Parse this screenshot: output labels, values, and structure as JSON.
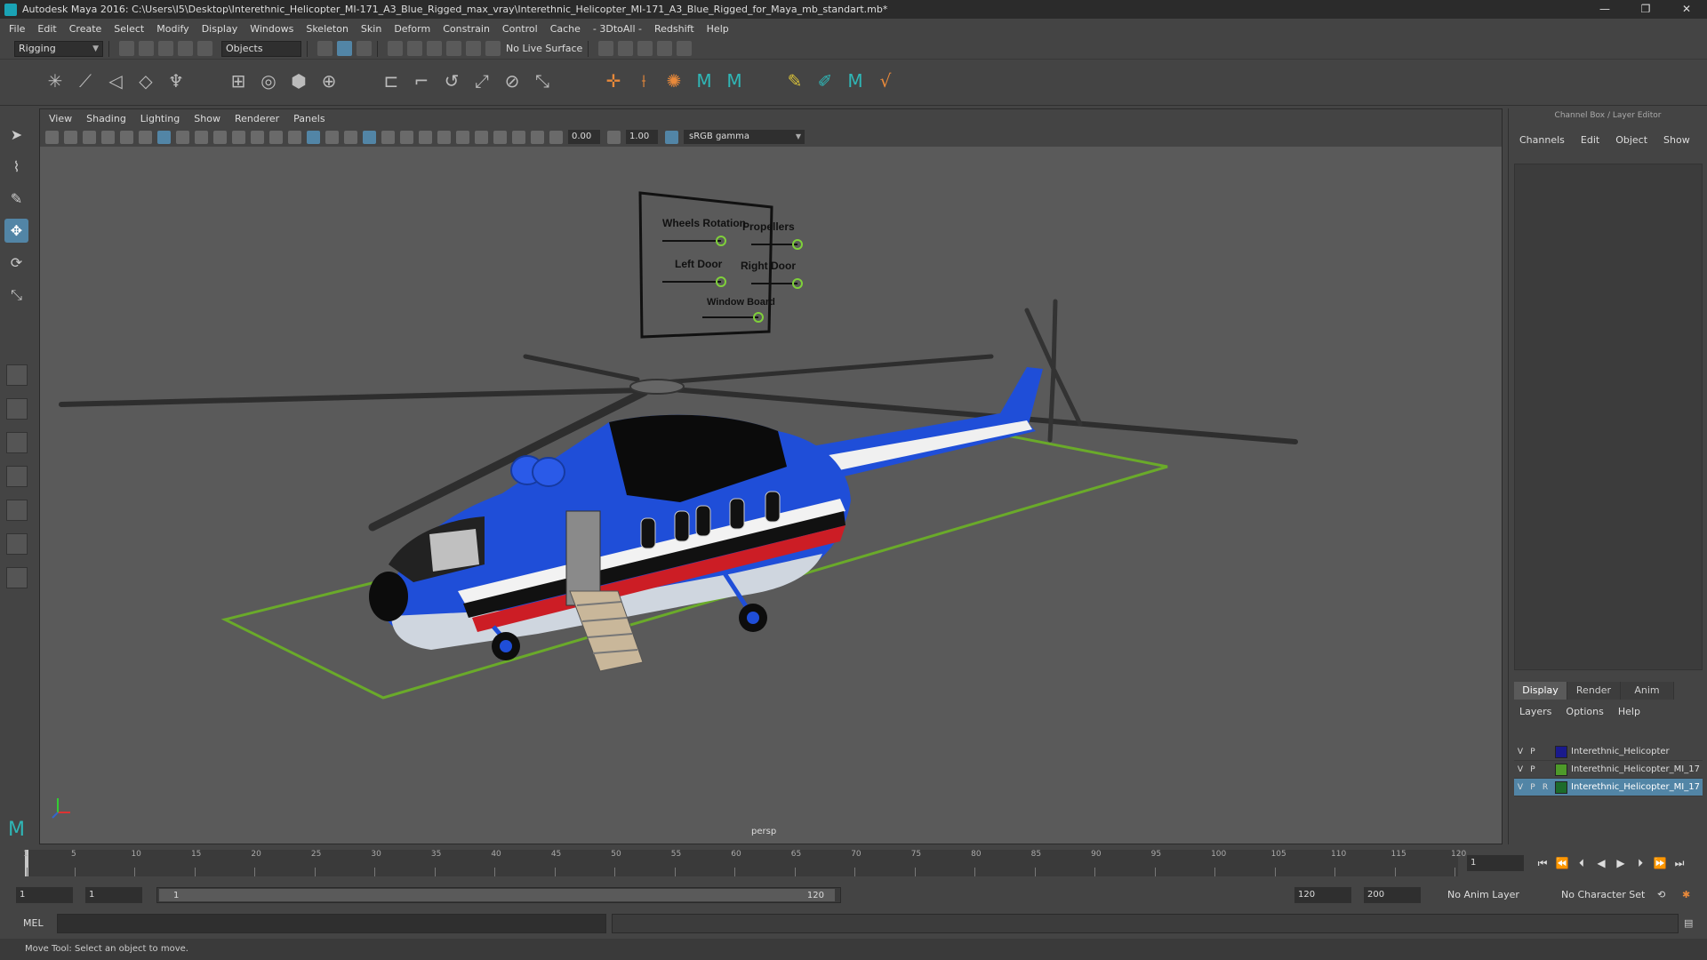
{
  "window": {
    "title": "Autodesk Maya 2016: C:\\Users\\I5\\Desktop\\Interethnic_Helicopter_MI-171_A3_Blue_Rigged_max_vray\\Interethnic_Helicopter_MI-171_A3_Blue_Rigged_for_Maya_mb_standart.mb*",
    "minimize": "—",
    "maximize": "❐",
    "close": "✕"
  },
  "menus": [
    "File",
    "Edit",
    "Create",
    "Select",
    "Modify",
    "Display",
    "Windows",
    "Skeleton",
    "Skin",
    "Deform",
    "Constrain",
    "Control",
    "Cache",
    "- 3DtoAll -",
    "Redshift",
    "Help"
  ],
  "status": {
    "mode": "Rigging",
    "objects_label": "Objects",
    "live_surface": "No Live Surface"
  },
  "viewport": {
    "menus": [
      "View",
      "Shading",
      "Lighting",
      "Show",
      "Renderer",
      "Panels"
    ],
    "exposure": "0.00",
    "gamma": "1.00",
    "color_space": "sRGB gamma",
    "camera": "persp",
    "rig_panel": {
      "labels": [
        "Wheels Rotation",
        "Propellers",
        "Left Door",
        "Right Door",
        "Window Board"
      ]
    }
  },
  "channel_box": {
    "title": "Channel Box / Layer Editor",
    "menus": [
      "Channels",
      "Edit",
      "Object",
      "Show"
    ],
    "layer_tabs": [
      "Display",
      "Render",
      "Anim"
    ],
    "layer_menus": [
      "Layers",
      "Options",
      "Help"
    ],
    "layers": [
      {
        "v": "V",
        "p": "P",
        "r": "",
        "name": "Interethnic_Helicopter",
        "color": "#1a1a8c",
        "selected": false
      },
      {
        "v": "V",
        "p": "P",
        "r": "",
        "name": "Interethnic_Helicopter_MI_17",
        "color": "#4e9a2a",
        "selected": false
      },
      {
        "v": "V",
        "p": "P",
        "r": "R",
        "name": "Interethnic_Helicopter_MI_17",
        "color": "#1d6b2b",
        "selected": true
      }
    ]
  },
  "timeline": {
    "ticks": [
      "1",
      "5",
      "10",
      "15",
      "20",
      "25",
      "30",
      "35",
      "40",
      "45",
      "50",
      "55",
      "60",
      "65",
      "70",
      "75",
      "80",
      "85",
      "90",
      "95",
      "100",
      "105",
      "110",
      "115",
      "120"
    ],
    "current_frame": "1"
  },
  "range": {
    "start": "1",
    "start_inner": "1",
    "range_start": "1",
    "range_end": "120",
    "end_inner": "120",
    "end": "200",
    "anim_layer": "No Anim Layer",
    "character_set": "No Character Set"
  },
  "command": {
    "mel_label": "MEL"
  },
  "help_line": "Move Tool: Select an object to move."
}
